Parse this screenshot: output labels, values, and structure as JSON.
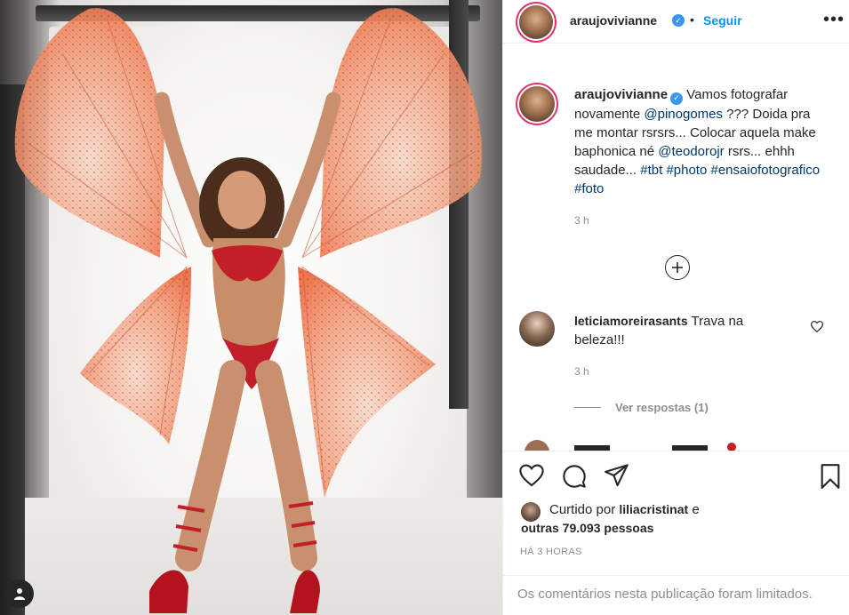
{
  "post": {
    "author": "araujovivianne",
    "follow_label": "Seguir",
    "separator": "•",
    "more_label": "•••"
  },
  "caption": {
    "username": "araujovivianne",
    "text_1": "Vamos fotografar novamente ",
    "mention_1": "@pinogomes",
    "text_2": " ??? Doida pra me montar rsrsrs... Colocar aquela make baphonica né ",
    "mention_2": "@teodorojr",
    "text_3": " rsrs... ehhh saudade... ",
    "hashtag_1": "#tbt",
    "hashtag_2": "#photo",
    "hashtag_3": "#ensaiofotografico",
    "hashtag_4": "#foto",
    "time": "3 h"
  },
  "comment": {
    "username": "leticiamoreirasants",
    "text": "Trava na beleza!!!",
    "time": "3 h",
    "view_replies": "Ver respostas (1)"
  },
  "likes": {
    "prefix": "Curtido por ",
    "user": "liliacristinat",
    "connector": " e",
    "others": "outras 79.093 pessoas"
  },
  "posted_time": "HÁ 3 HORAS",
  "comments_limited": "Os comentários nesta publicação foram limitados.",
  "colors": {
    "accent": "#0095f6",
    "verified": "#3897f0",
    "muted": "#8e8e8e",
    "link": "#00376b",
    "wing": "#f07a4f"
  },
  "icons": [
    "verified-badge-icon",
    "more-options-icon",
    "add-comment-icon",
    "heart-icon",
    "comment-icon",
    "share-icon",
    "bookmark-icon",
    "user-tag-icon"
  ]
}
